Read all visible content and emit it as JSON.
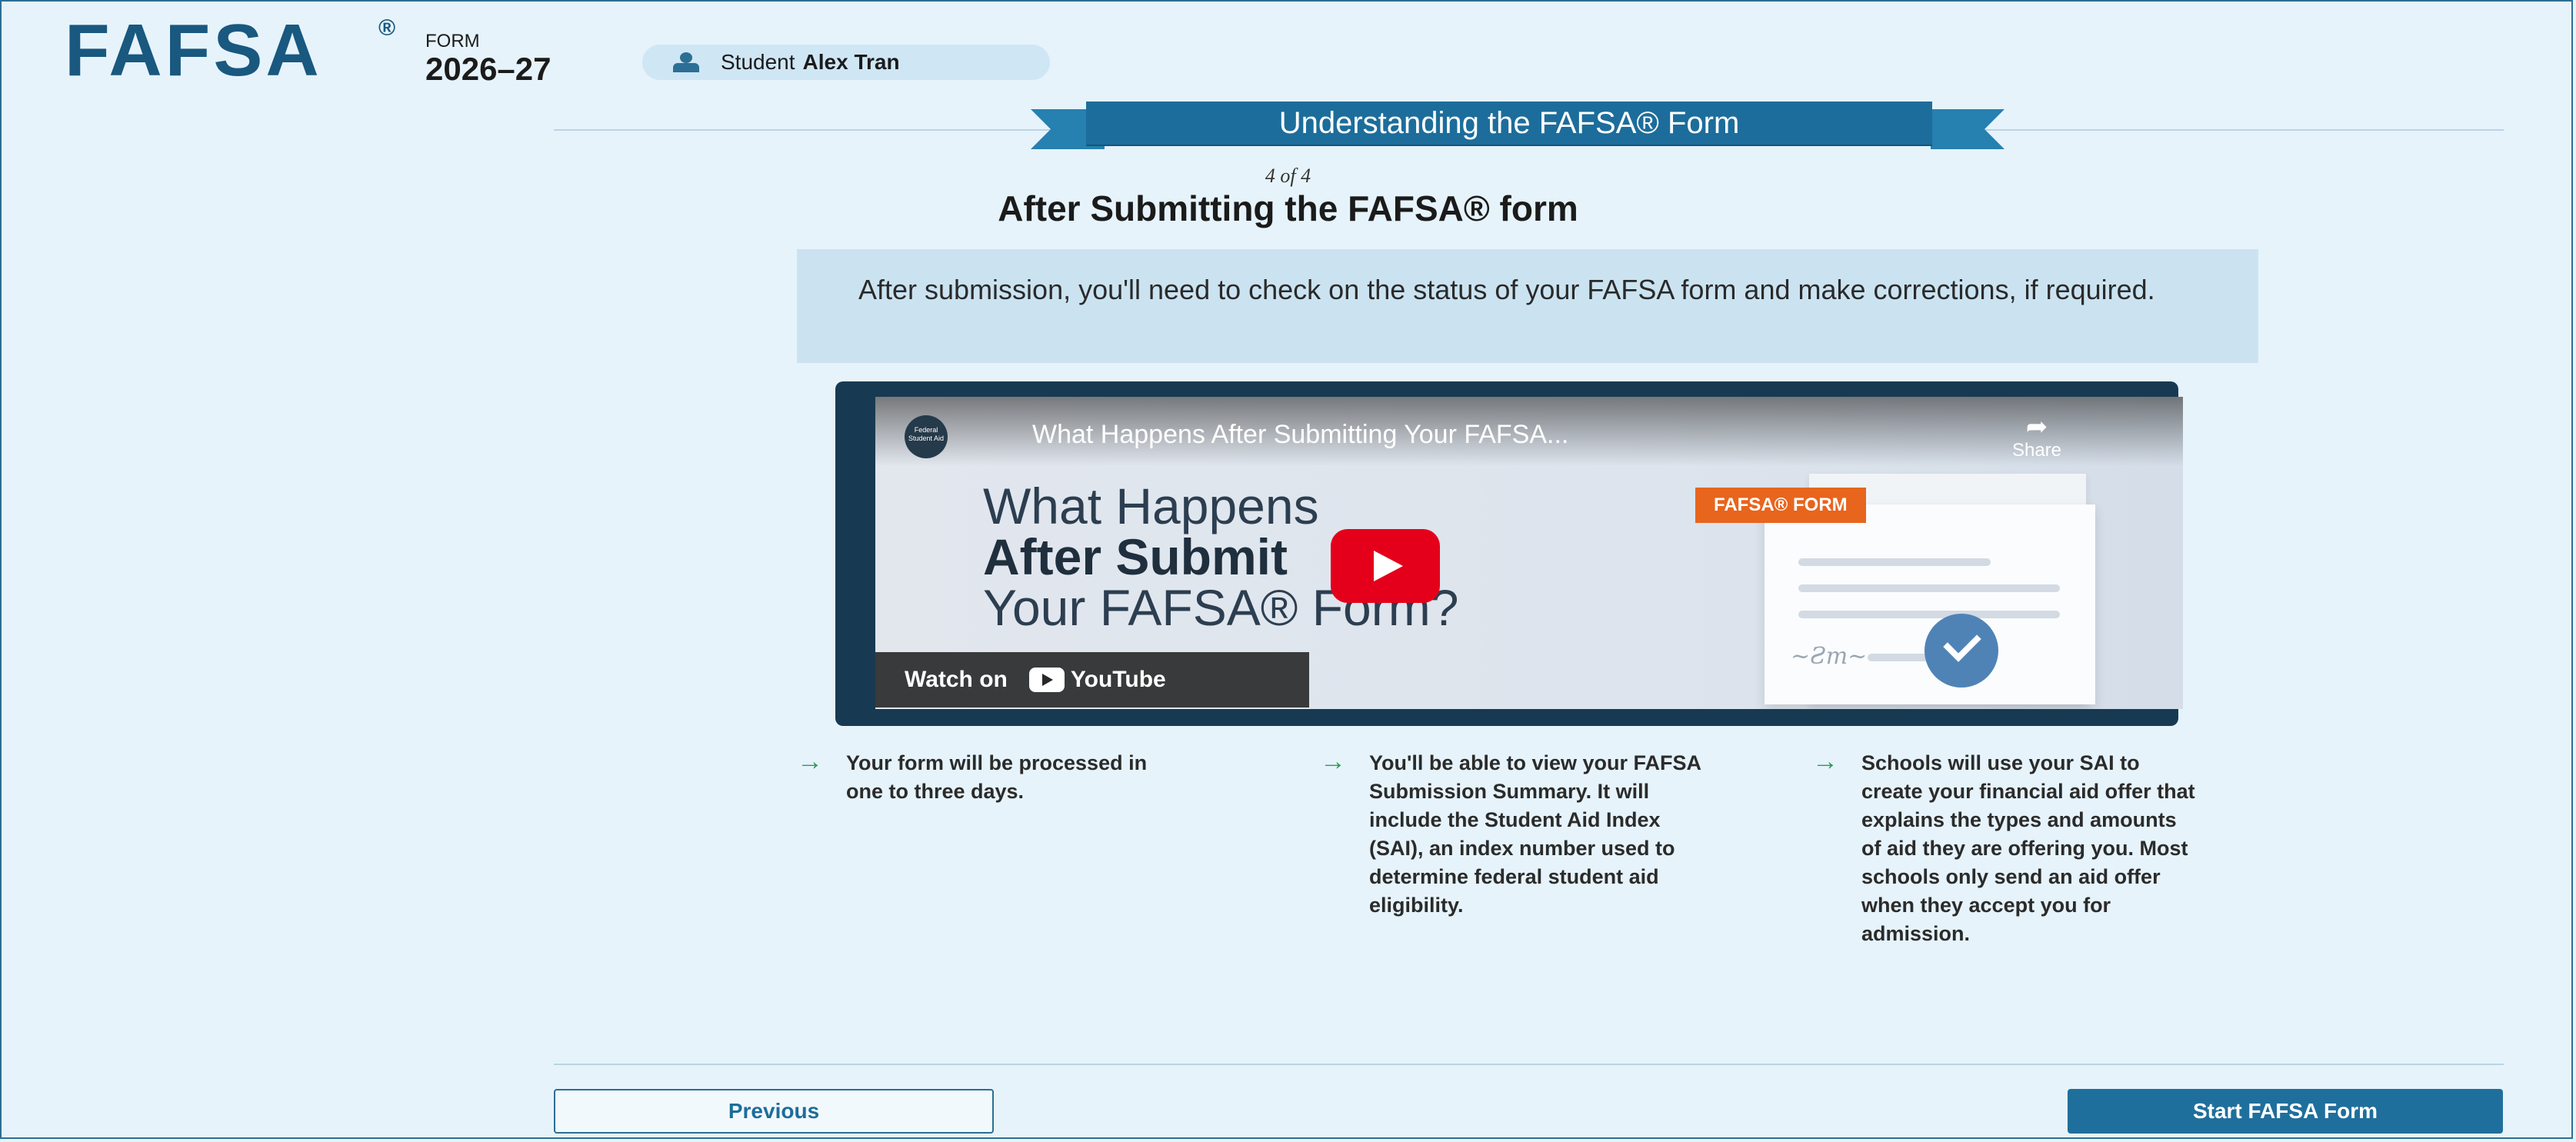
{
  "header": {
    "logo": "FAFSA",
    "logo_mark": "®",
    "form_label": "FORM",
    "form_year": "2026–27",
    "student_label": "Student",
    "student_name": "Alex Tran"
  },
  "banner": {
    "title": "Understanding the FAFSA® Form"
  },
  "step": {
    "counter": "4 of 4",
    "title": "After Submitting the FAFSA® form"
  },
  "intro": "After submission, you'll need to check on the status of your FAFSA form and make corrections, if required.",
  "video": {
    "channel_text": "Federal Student Aid",
    "title": "What Happens After Submitting Your FAFSA...",
    "share_label": "Share",
    "line1": "What Happens",
    "line2": "After Submit",
    "line3": "Your FAFSA® Form?",
    "tag": "FAFSA® FORM",
    "watch_on": "Watch on",
    "youtube": "YouTube",
    "icon": "play-icon"
  },
  "bullets": [
    "Your form will be processed in one to three days.",
    "You'll be able to view your FAFSA Submission Summary. It will include the Student Aid Index (SAI), an index number used to determine federal student aid eligibility.",
    "Schools will use your SAI to create your financial aid offer that explains the types and amounts of aid they are offering you. Most schools only send an aid offer when they accept you for admission."
  ],
  "buttons": {
    "previous": "Previous",
    "start": "Start FAFSA Form"
  },
  "colors": {
    "brand": "#19587f",
    "accent": "#1c6d9b",
    "background": "#e6f3fb",
    "arrow": "#2a9d57"
  }
}
